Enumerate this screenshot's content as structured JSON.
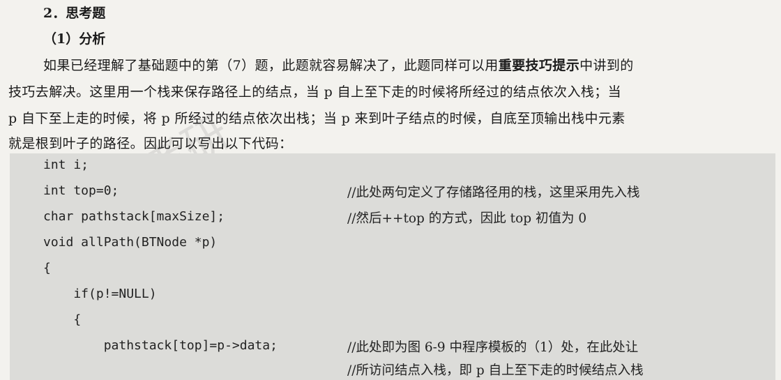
{
  "section": {
    "heading": "2．思考题",
    "subheading": "（1）分析"
  },
  "paragraph": {
    "line1_pre": "如果已经理解了基础题中的第（7）题，此题就容易解决了，此题同样可以用",
    "line1_bold": "重要技巧提示",
    "line1_post": "中讲到的",
    "line2": "技巧去解决。这里用一个栈来保存路径上的结点，当 p 自上至下走的时候将所经过的结点依次入栈；当",
    "line3": "p 自下至上走的时候，将 p 所经过的结点依次出栈；当 p 来到叶子结点的时候，自底至顶输出栈中元素",
    "line4": "就是根到叶子的路径。因此可以写出以下代码："
  },
  "code": {
    "lines": [
      "int i;",
      "int top=0;",
      "char pathstack[maxSize];",
      "void allPath(BTNode *p)",
      "{",
      "    if(p!=NULL)",
      "    {",
      "        pathstack[top]=p->data;"
    ],
    "comments": [
      "//此处两句定义了存储路径用的栈，这里采用先入栈",
      "//然后++top 的方式，因此 top 初值为 0",
      "//此处即为图 6-9 中程序模板的（1）处，在此处让",
      "//所访问结点入栈，即 p 自上至下走的时候结点入栈"
    ]
  },
  "watermark": "计算机考研"
}
